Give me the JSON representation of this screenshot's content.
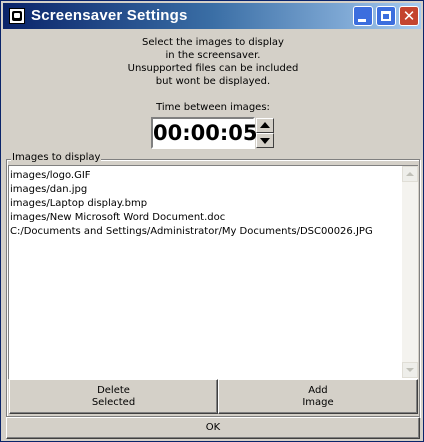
{
  "window": {
    "title": "Screensaver Settings"
  },
  "title_buttons": {
    "minimize_icon": "minimize-icon",
    "maximize_icon": "maximize-icon",
    "close_icon": "close-icon"
  },
  "instructions": {
    "line1": "Select the images to display",
    "line2": "in the screensaver.",
    "line3": "Unsupported files can be included",
    "line4": "but wont be displayed."
  },
  "time": {
    "label": "Time between images:",
    "value": "00:00:05"
  },
  "images": {
    "group_label": "Images to display",
    "items": [
      "images/logo.GIF",
      "images/dan.jpg",
      "images/Laptop display.bmp",
      "images/New Microsoft Word Document.doc",
      "C:/Documents and Settings/Administrator/My Documents/DSC00026.JPG"
    ]
  },
  "buttons": {
    "delete_label": "Delete\nSelected",
    "add_label": "Add\nImage",
    "ok_label": "OK"
  },
  "colors": {
    "titlebar_start": "#0a246a",
    "titlebar_end": "#a6caf0",
    "face": "#d4d0c8",
    "close_button": "#c4442f"
  }
}
